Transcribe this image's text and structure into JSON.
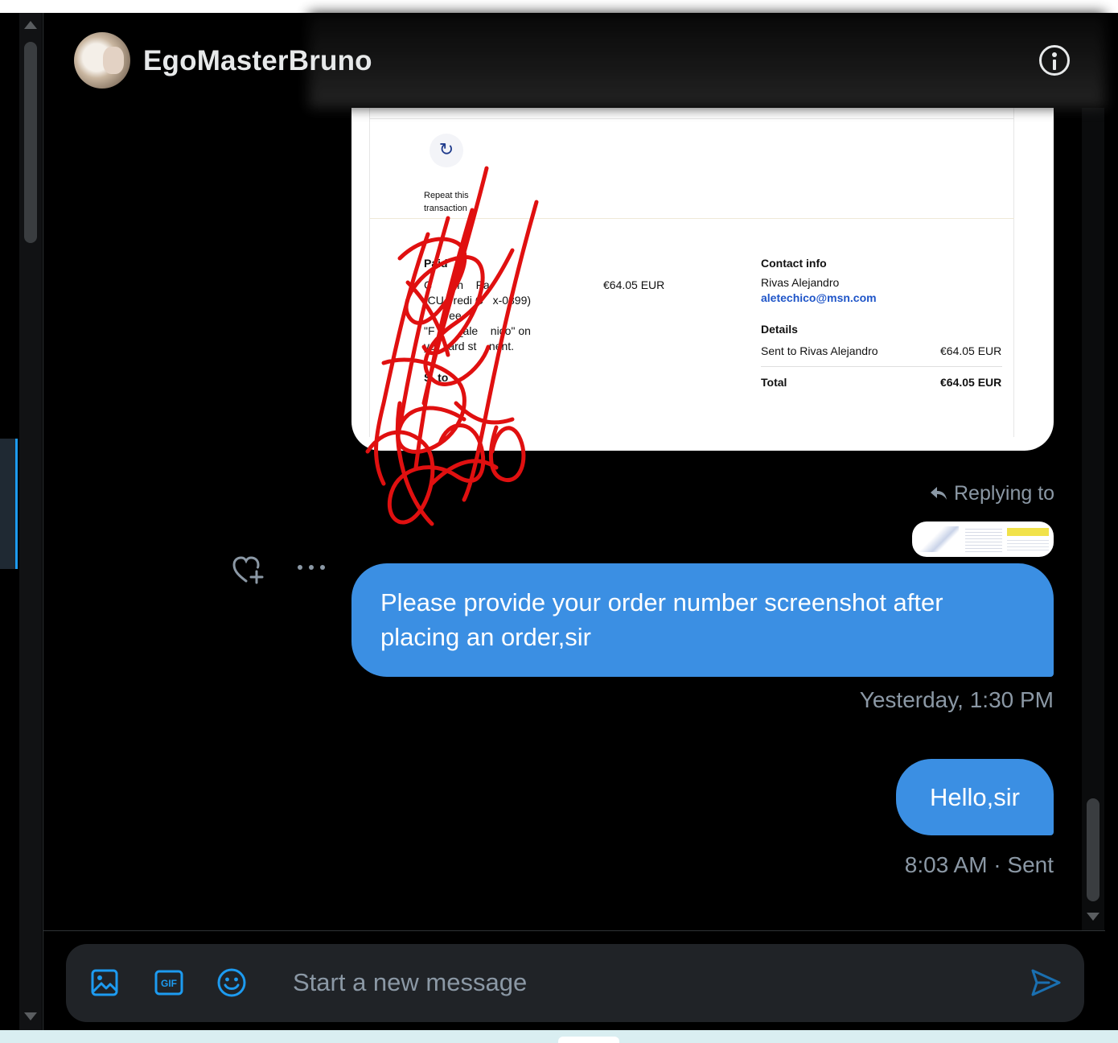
{
  "conversation": {
    "username": "EgoMasterBruno"
  },
  "receipt": {
    "repeat_label_line1": "Repeat this",
    "repeat_label_line2": "transaction",
    "paid_label": "Paid",
    "paid_line1": "C        n    Pa",
    "paid_line2": "(CU   redi C   x-0899)",
    "paid_line3": "        ee",
    "paid_line4": "\"F       _ale    nico\" on",
    "paid_line5": "yo    ard st    nent.",
    "ship_to_label": "S  to",
    "amount": "€64.05 EUR",
    "contact_info_label": "Contact info",
    "contact_name": "Rivas Alejandro",
    "contact_email": "aletechico@msn.com",
    "details_label": "Details",
    "sent_to_label": "Sent to Rivas Alejandro",
    "sent_to_amount": "€64.05 EUR",
    "total_label": "Total",
    "total_amount": "€64.05 EUR"
  },
  "reply": {
    "label": "Replying to"
  },
  "messages": [
    {
      "text": "Please provide your order number screenshot after placing an order,sir",
      "meta": "Yesterday, 1:30 PM"
    },
    {
      "text": "Hello,sir",
      "meta": "8:03 AM · Sent"
    }
  ],
  "composer": {
    "placeholder": "Start a new message",
    "gif_label": "GIF"
  },
  "colors": {
    "accent": "#1d9bf0",
    "bubble": "#3b8fe3",
    "background": "#000000",
    "muted_text": "#8b98a5",
    "annotation_red": "#e01010"
  }
}
